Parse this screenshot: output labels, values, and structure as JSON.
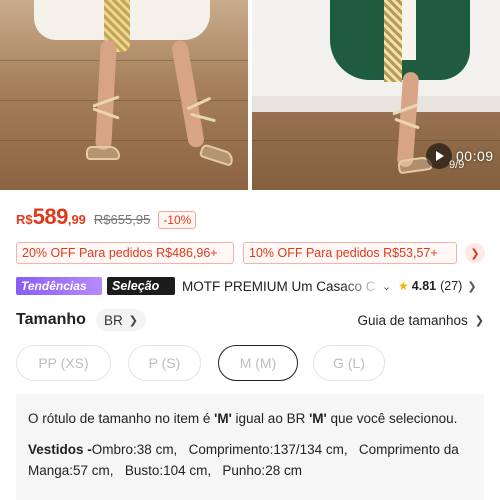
{
  "gallery": {
    "video_time": "00:09",
    "page_count": "9/9"
  },
  "price": {
    "currency": "R$",
    "main": "589",
    "cents": ",99",
    "original": "R$655,95",
    "discount": "-10%",
    "color": "#e03a1a"
  },
  "coupons": [
    {
      "text": "20% OFF Para pedidos R$486,96+"
    },
    {
      "text": "10% OFF Para pedidos R$53,57+"
    }
  ],
  "product": {
    "tag_trend": "Tendências",
    "tag_selection": "Seleção",
    "title": "MOTF PREMIUM Um Casaco C",
    "rating": "4.81",
    "reviews": "(27)"
  },
  "size": {
    "title": "Tamanho",
    "region": "BR",
    "guide_label": "Guia de tamanhos",
    "options": [
      "PP (XS)",
      "P (S)",
      "M (M)",
      "G (L)"
    ],
    "selected": "M (M)"
  },
  "info": {
    "label_text_prefix": "O rótulo de tamanho no item é ",
    "label_size": "'M'",
    "label_text_mid": " igual ao BR ",
    "label_size2": "'M'",
    "label_text_suffix": " que você selecionou.",
    "measure_category": "Vestidos -",
    "m1_label": "Ombro:",
    "m1_value": "38 cm,",
    "m2_label": "Comprimento:",
    "m2_value": "137/134 cm,",
    "m3_label": "Comprimento da Manga:",
    "m3_value": "57 cm,",
    "m4_label": "Busto:",
    "m4_value": "104 cm,",
    "m5_label": "Punho:",
    "m5_value": "28 cm"
  }
}
